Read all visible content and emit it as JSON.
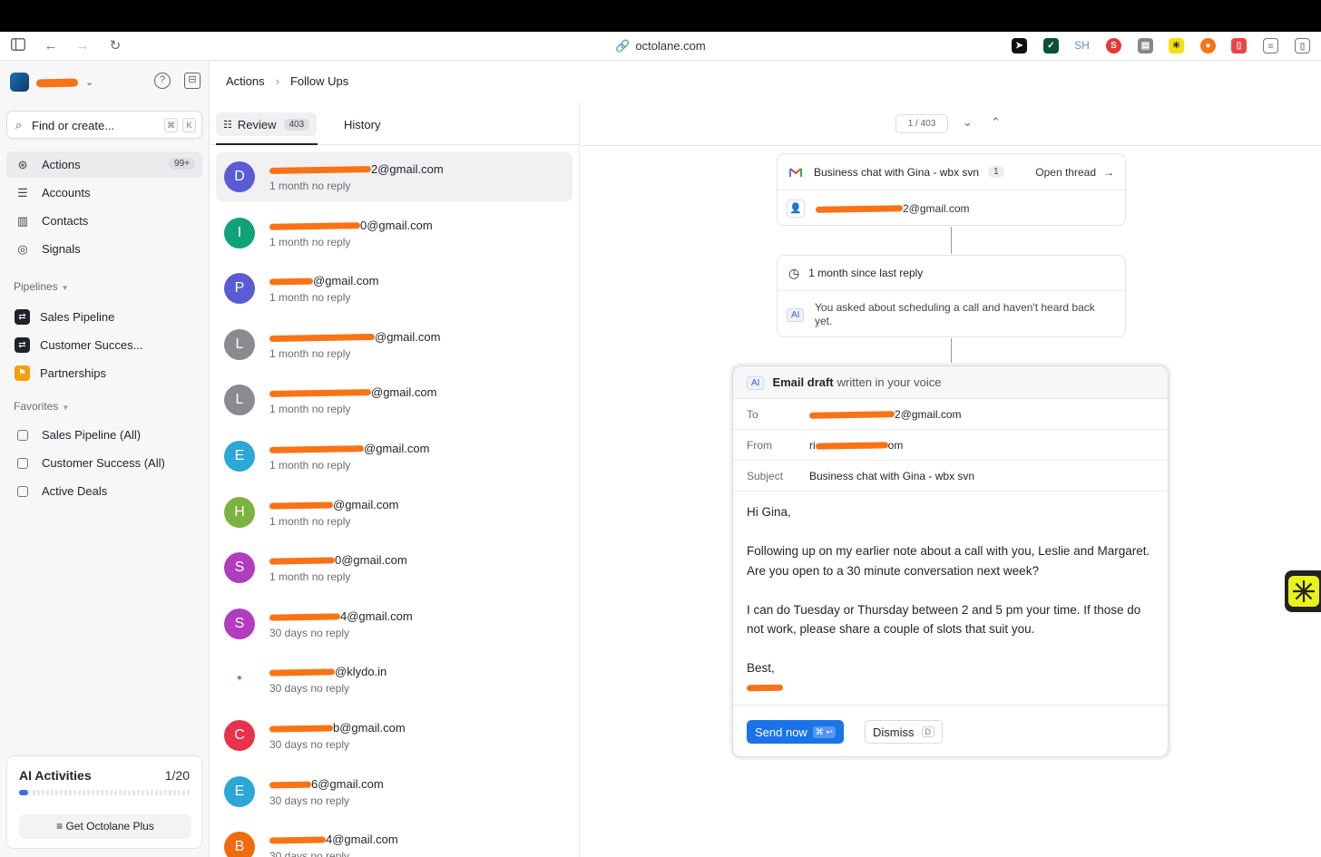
{
  "browser": {
    "url": "octolane.com",
    "extension_label_sh": "SH"
  },
  "sidebar": {
    "search_placeholder": "Find or create...",
    "search_kbd1": "⌘",
    "search_kbd2": "K",
    "nav": [
      {
        "label": "Actions",
        "badge": "99+",
        "icon": "actions-icon"
      },
      {
        "label": "Accounts",
        "icon": "accounts-icon"
      },
      {
        "label": "Contacts",
        "icon": "contacts-icon"
      },
      {
        "label": "Signals",
        "icon": "signals-icon"
      }
    ],
    "pipelines_heading": "Pipelines",
    "pipelines": [
      {
        "label": "Sales Pipeline",
        "color": "#1f2328"
      },
      {
        "label": "Customer Succes...",
        "color": "#1f2328"
      },
      {
        "label": "Partnerships",
        "color": "#f59e0b"
      }
    ],
    "favorites_heading": "Favorites",
    "favorites": [
      {
        "label": "Sales Pipeline (All)"
      },
      {
        "label": "Customer Success (All)"
      },
      {
        "label": "Active Deals"
      }
    ],
    "ai_card": {
      "title": "AI Activities",
      "count": "1/20",
      "progress": 0.05,
      "button": "Get Octolane Plus"
    }
  },
  "breadcrumb": {
    "parent": "Actions",
    "current": "Follow Ups"
  },
  "list": {
    "tabs": {
      "review": "Review",
      "review_count": "403",
      "history": "History"
    },
    "items": [
      {
        "letter": "D",
        "color": "#5b5bd6",
        "email_suffix": "2@gmail.com",
        "status": "1 month no reply"
      },
      {
        "letter": "I",
        "color": "#12a27a",
        "email_suffix": "0@gmail.com",
        "status": "1 month no reply"
      },
      {
        "letter": "P",
        "color": "#5b5bd6",
        "email_suffix": "@gmail.com",
        "status": "1 month no reply"
      },
      {
        "letter": "L",
        "color": "#8a8a8f",
        "email_suffix": "@gmail.com",
        "status": "1 month no reply"
      },
      {
        "letter": "L",
        "color": "#8a8a8f",
        "email_suffix": "@gmail.com",
        "status": "1 month no reply"
      },
      {
        "letter": "E",
        "color": "#2ba7d8",
        "email_suffix": "@gmail.com",
        "status": "1 month no reply"
      },
      {
        "letter": "H",
        "color": "#7ab33f",
        "email_suffix": "@gmail.com",
        "status": "1 month no reply"
      },
      {
        "letter": "S",
        "color": "#b13cc0",
        "email_suffix": "0@gmail.com",
        "status": "1 month no reply"
      },
      {
        "letter": "S",
        "color": "#b13cc0",
        "email_suffix": "4@gmail.com",
        "status": "30 days no reply"
      },
      {
        "letter": "",
        "color": "#ffffff",
        "email_suffix": "@klydo.in",
        "status": "30 days no reply"
      },
      {
        "letter": "C",
        "color": "#e8314a",
        "email_suffix": "b@gmail.com",
        "status": "30 days no reply"
      },
      {
        "letter": "E",
        "color": "#2ba7d8",
        "email_suffix": "6@gmail.com",
        "status": "30 days no reply"
      },
      {
        "letter": "B",
        "color": "#f06a0f",
        "email_suffix": "4@gmail.com",
        "status": "30 days no reply"
      }
    ]
  },
  "detail": {
    "pager": "1 / 403",
    "thread": {
      "subject": "Business chat with Gina - wbx svn",
      "count": "1",
      "open_label": "Open thread",
      "contact_suffix": "2@gmail.com"
    },
    "insight": {
      "since": "1 month since last reply",
      "ai_tag": "AI",
      "summary": "You asked about scheduling a call and haven't heard back yet."
    },
    "draft": {
      "ai_tag": "AI",
      "title_bold": "Email draft",
      "title_rest": "written in your voice",
      "to_label": "To",
      "to_suffix": "2@gmail.com",
      "from_label": "From",
      "from_prefix": "ri",
      "from_suffix": "om",
      "subject_label": "Subject",
      "subject": "Business chat with Gina - wbx svn",
      "greeting": "Hi Gina,",
      "para1": "Following up on my earlier note about a call with you, Leslie and Margaret. Are you open to a 30 minute conversation next week?",
      "para2": "I can do Tuesday or Thursday between 2 and 5 pm your time. If those do not work, please share a couple of slots that suit you.",
      "signoff": "Best,",
      "send_label": "Send now",
      "send_kbd": "⌘ ↩",
      "dismiss_label": "Dismiss",
      "dismiss_kbd": "D"
    }
  }
}
